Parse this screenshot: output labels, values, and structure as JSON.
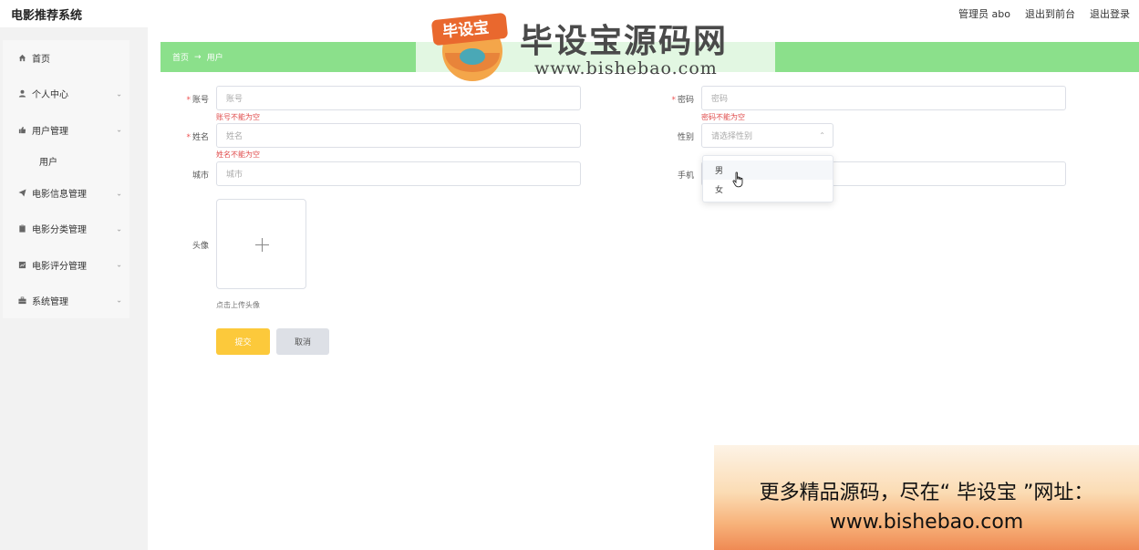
{
  "header": {
    "app_title": "电影推荐系统",
    "user": "管理员 abo",
    "to_front": "退出到前台",
    "logout": "退出登录"
  },
  "sidebar": {
    "items": [
      {
        "label": "首页",
        "icon": "home-icon"
      },
      {
        "label": "个人中心",
        "icon": "user-icon"
      },
      {
        "label": "用户管理",
        "icon": "thumb-icon"
      },
      {
        "label": "电影信息管理",
        "icon": "send-icon"
      },
      {
        "label": "电影分类管理",
        "icon": "clipboard-icon"
      },
      {
        "label": "电影评分管理",
        "icon": "chart-icon"
      },
      {
        "label": "系统管理",
        "icon": "briefcase-icon"
      }
    ],
    "sub_user": "用户"
  },
  "breadcrumb": {
    "home": "首页",
    "arrow": "→",
    "current": "用户"
  },
  "form": {
    "account": {
      "label": "账号",
      "placeholder": "账号",
      "error": "账号不能为空"
    },
    "password": {
      "label": "密码",
      "placeholder": "密码",
      "error": "密码不能为空"
    },
    "name": {
      "label": "姓名",
      "placeholder": "姓名",
      "error": "姓名不能为空"
    },
    "gender": {
      "label": "性别",
      "placeholder": "请选择性别",
      "options": [
        "男",
        "女"
      ]
    },
    "city": {
      "label": "城市",
      "placeholder": "城市"
    },
    "phone": {
      "label": "手机"
    },
    "avatar": {
      "label": "头像",
      "tip": "点击上传头像"
    },
    "required_mark": "*",
    "submit": "提交",
    "cancel": "取消"
  },
  "watermark": {
    "badge": "毕设宝",
    "name": "毕设宝源码网",
    "url": "www.bishebao.com"
  },
  "promo": {
    "line1": "更多精品源码，尽在“ 毕设宝 ”网址：",
    "line2": "www.bishebao.com"
  },
  "colors": {
    "breadcrumb_bg": "#8be08b",
    "submit_bg": "#fcc93b",
    "error": "#e04b4b"
  }
}
